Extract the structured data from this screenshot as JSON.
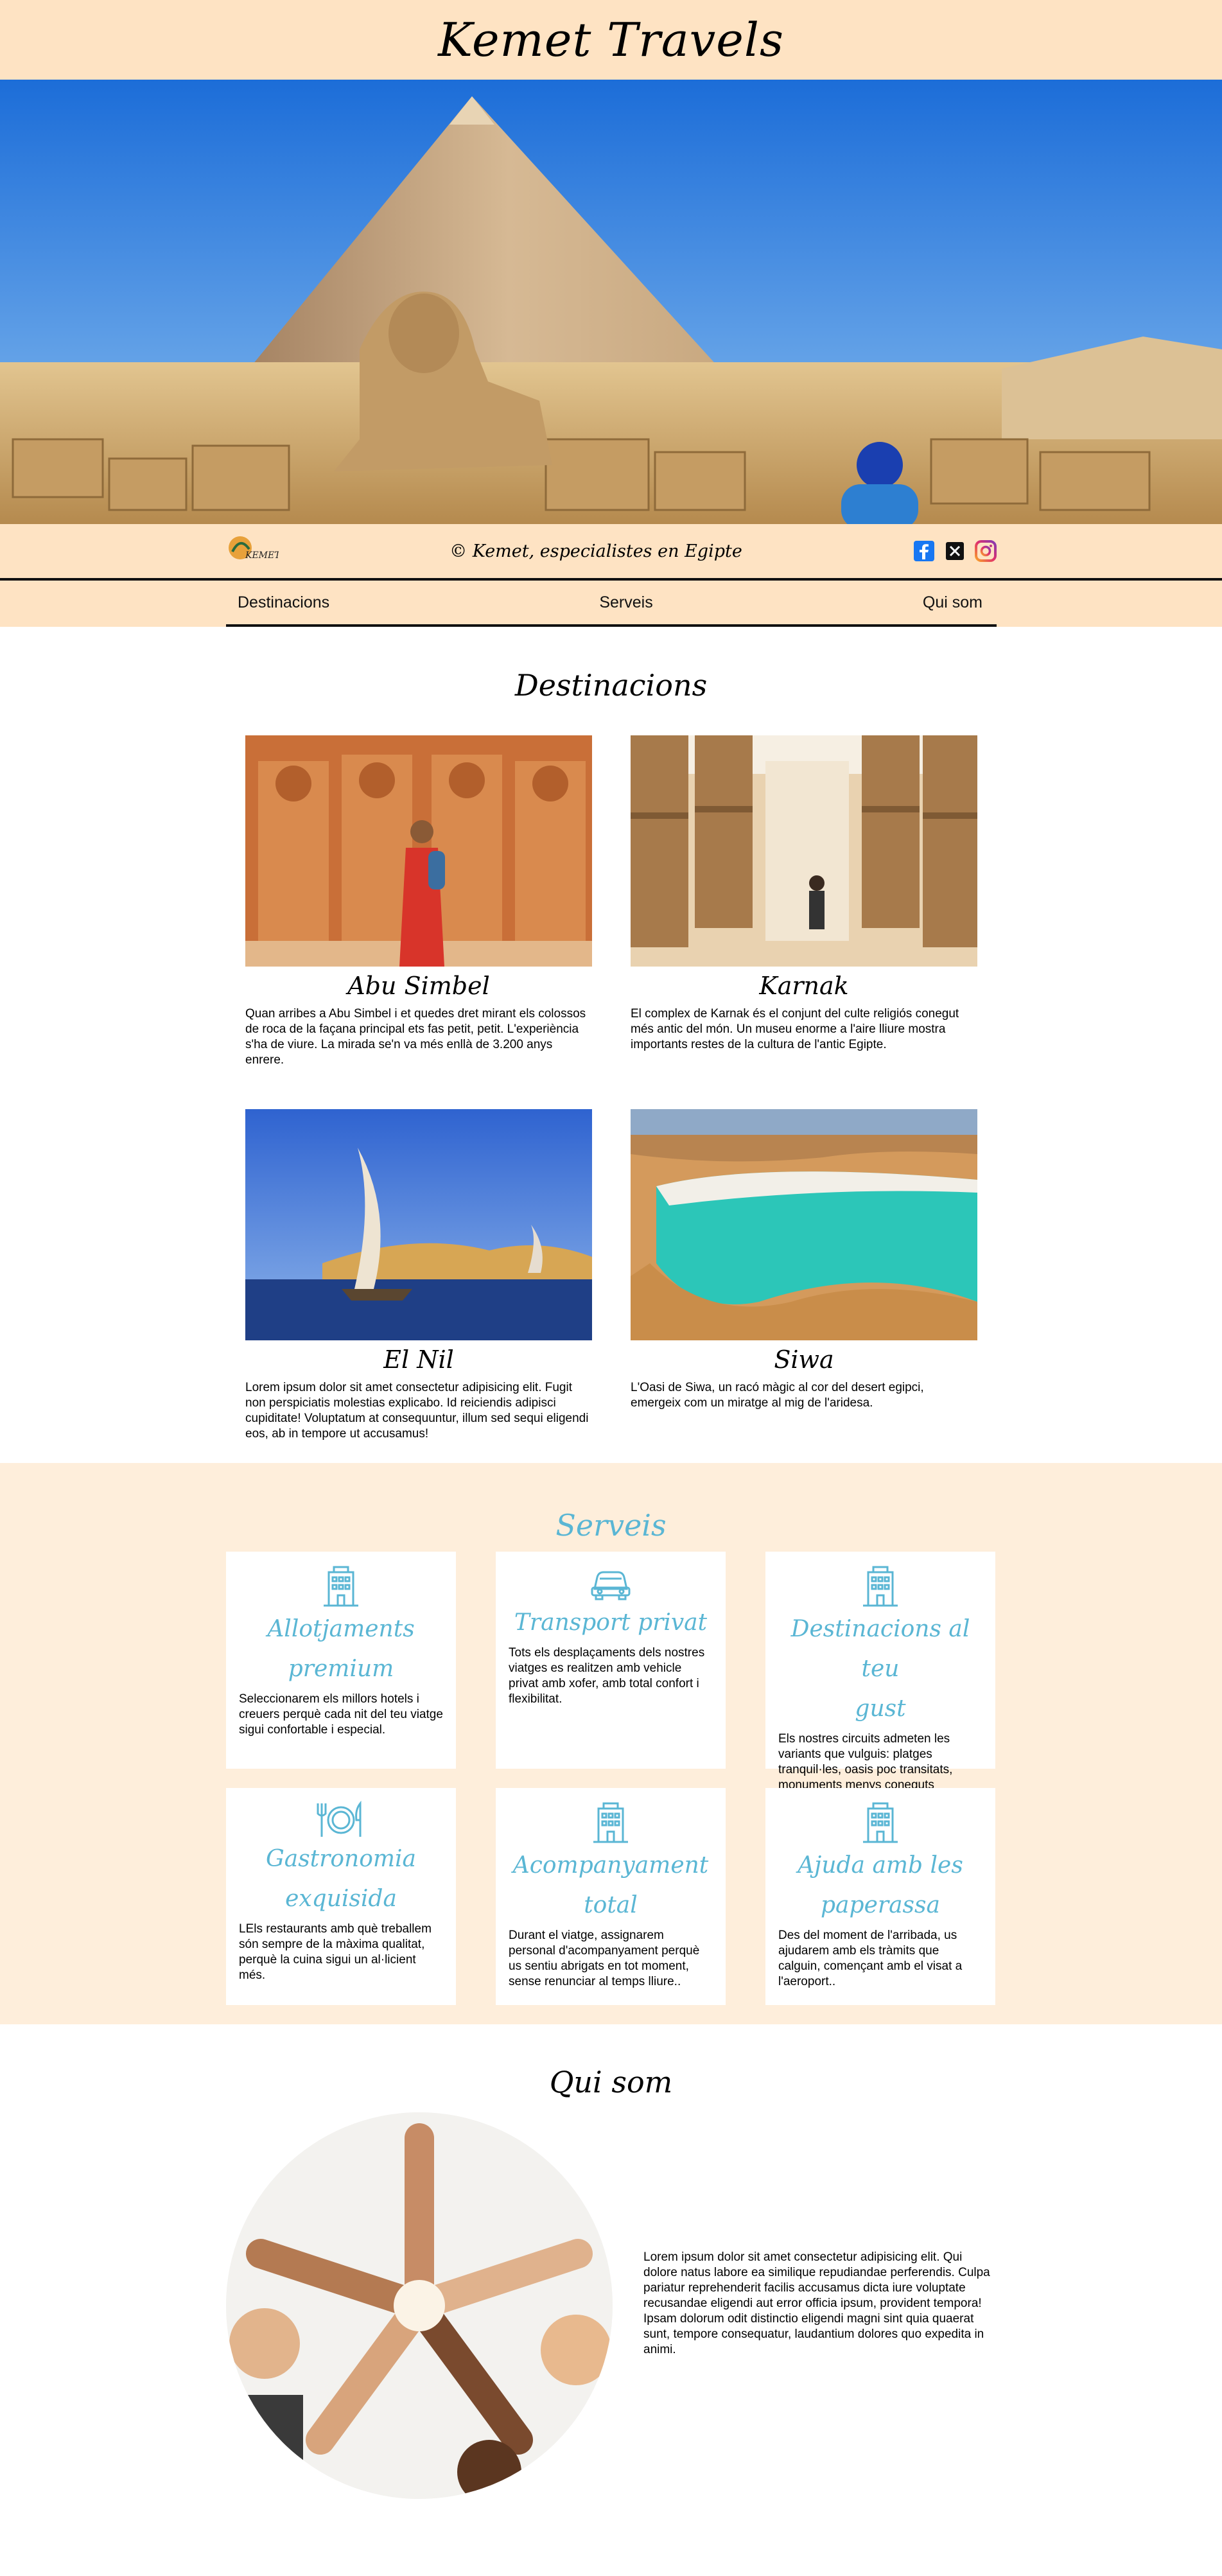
{
  "header": {
    "title": "Kemet Travels"
  },
  "hero": {
    "image": "pyramid-and-sphinx-photo"
  },
  "info": {
    "logo": "kemet-travels-logo",
    "logo_text": "KEMET",
    "copyright": "© Kemet, especialistes en Egipte",
    "social": [
      "facebook-icon",
      "x-icon",
      "instagram-icon"
    ]
  },
  "nav": {
    "items": [
      {
        "label": "Destinacions"
      },
      {
        "label": "Serveis"
      },
      {
        "label": "Qui som"
      }
    ]
  },
  "destinations": {
    "title": "Destinacions",
    "items": [
      {
        "name": "Abu Simbel",
        "text": "Quan arribes a Abu Simbel i et quedes dret mirant els colossos de roca de la façana principal ets fas petit, petit. L'experiència s'ha de viure. La mirada se'n va més enllà de 3.200 anys enrere."
      },
      {
        "name": "Karnak",
        "text": "El complex de Karnak és el conjunt del culte religiós conegut més antic del món. Un museu enorme a l'aire lliure mostra importants restes de la cultura de l'antic Egipte."
      },
      {
        "name": "El Nil",
        "text": "Lorem ipsum dolor sit amet consectetur adipisicing elit. Fugit non perspiciatis molestias explicabo. Id reiciendis adipisci cupiditate! Voluptatum at consequuntur, illum sed sequi eligendi eos, ab in tempore ut accusamus!"
      },
      {
        "name": "Siwa",
        "text": "L'Oasi de Siwa, un racó màgic al cor del desert egipci, emergeix com un miratge al mig de l'aridesa."
      }
    ]
  },
  "services": {
    "title": "Serveis",
    "accent_color": "#5ab6d4",
    "items": [
      {
        "icon": "hotel-icon",
        "title_line1": "Allotjaments",
        "title_line2": "premium",
        "text": "Seleccionarem els millors hotels i creuers perquè cada nit del teu viatge sigui confortable i especial."
      },
      {
        "icon": "car-icon",
        "title_line1": "Transport privat",
        "title_line2": "",
        "text": "Tots els desplaçaments dels nostres viatges es realitzen amb vehicle privat amb xofer, amb total confort i flexibilitat."
      },
      {
        "icon": "hotel-icon",
        "title_line1": "Destinacions al teu",
        "title_line2": "gust",
        "text": "Els nostres circuits admeten les variants que vulguis: platges tranquil·les, oasis poc transitats, monuments menys coneguts"
      },
      {
        "icon": "cutlery-plate-icon",
        "title_line1": "Gastronomia",
        "title_line2": "exquisida",
        "text": "LEls restaurants amb què treballem són sempre de la màxima qualitat, perquè la cuina sigui un al·licient més."
      },
      {
        "icon": "hotel-icon",
        "title_line1": "Acompanyament",
        "title_line2": "total",
        "text": "Durant el viatge, assignarem personal d'acompanyament perquè us sentiu abrigats en tot moment, sense renunciar al temps lliure.."
      },
      {
        "icon": "hotel-icon",
        "title_line1": "Ajuda amb les",
        "title_line2": "paperassa",
        "text": "Des del moment de l'arribada, us ajudarem amb els tràmits que calguin, començant amb el visat a l'aeroport.."
      }
    ]
  },
  "about": {
    "title": "Qui som",
    "image": "team-hands-star-photo",
    "text": "Lorem ipsum dolor sit amet consectetur adipisicing elit. Qui dolore natus labore ea similique repudiandae perferendis. Culpa pariatur reprehenderit facilis accusamus dicta iure voluptate recusandae eligendi aut error officia ipsum, provident tempora! Ipsam dolorum odit distinctio eligendi magni sint quia quaerat sunt, tempore consequatur, laudantium dolores quo expedita in animi."
  }
}
